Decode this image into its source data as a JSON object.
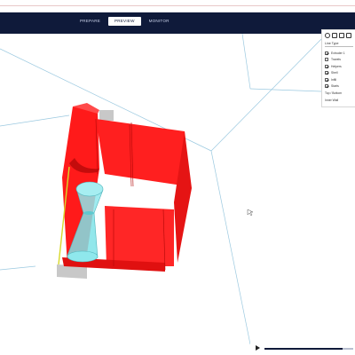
{
  "app": {
    "stages": [
      {
        "label": "PREPARE",
        "active": false
      },
      {
        "label": "PREVIEW",
        "active": true
      },
      {
        "label": "MONITOR",
        "active": false
      }
    ]
  },
  "view_panel": {
    "tool_icons": [
      "layer-view-icon",
      "xray-view-icon",
      "solid-view-icon",
      "settings-icon"
    ],
    "color_scheme": "Line Type",
    "line_types": [
      {
        "label": "Extruder 1",
        "checked": true
      },
      {
        "label": "Travels",
        "checked": false
      },
      {
        "label": "Helpers",
        "checked": true
      },
      {
        "label": "Shell",
        "checked": true
      },
      {
        "label": "Infill",
        "checked": true
      },
      {
        "label": "Starts",
        "checked": true
      }
    ],
    "extra_items": [
      "Top / Bottom",
      "Inner Wall"
    ]
  },
  "playback": {
    "progress": 0.88
  },
  "colors": {
    "appbar": "#0f1a3a",
    "model_red": "#ff1a1a",
    "support_cyan": "#7fe6ea",
    "grid_line": "#9bc9e0"
  }
}
